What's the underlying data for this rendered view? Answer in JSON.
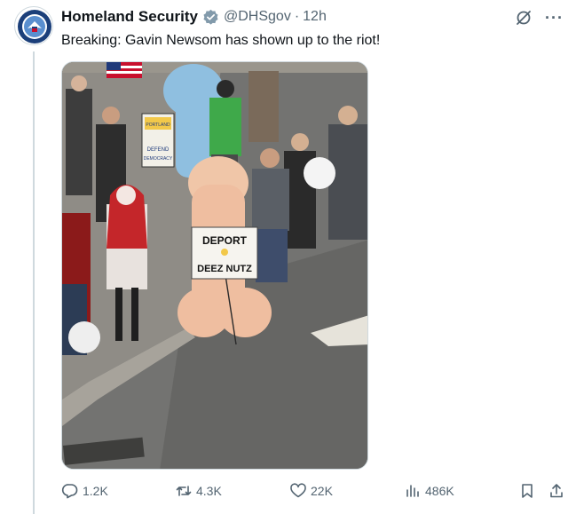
{
  "tweet": {
    "author_name": "Homeland Security",
    "handle": "@DHSgov",
    "separator": "·",
    "time": "12h",
    "text": "Breaking: Gavin Newsom has shown up to the riot!",
    "avatar_icon": "dhs-seal-icon",
    "verified_icon": "verified-badge-icon",
    "more_icon": "more-icon",
    "grok_icon": "grok-icon"
  },
  "media": {
    "sign_left": {
      "line1": "PORTLAND",
      "line2": "DEFEND",
      "line3": "DEMOCRACY"
    },
    "sign_main": {
      "line1": "DEPORT",
      "line2": "DEEZ NUTZ"
    }
  },
  "stats": {
    "replies": "1.2K",
    "reposts": "4.3K",
    "likes": "22K",
    "views": "486K"
  },
  "colors": {
    "text": "#0f1419",
    "secondary": "#536471",
    "border": "#cfd9de",
    "verified": "#829aab"
  }
}
